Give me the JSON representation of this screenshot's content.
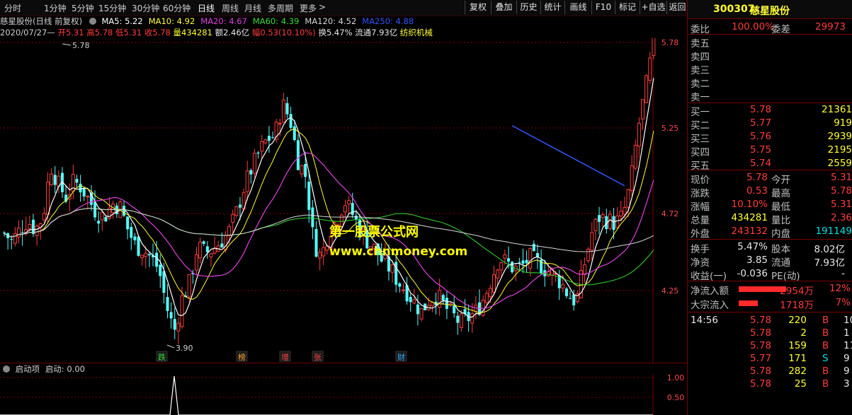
{
  "periods": [
    "分时",
    "1分钟",
    "5分钟",
    "15分钟",
    "30分钟",
    "60分钟",
    "日线",
    "周线",
    "月线",
    "多周期",
    "更多"
  ],
  "active_period": "日线",
  "more_arrow": ">",
  "toolbar": [
    "复权",
    "叠加",
    "历史",
    "统计",
    "画线",
    "F10",
    "标记",
    "+自选",
    "返回"
  ],
  "stock": {
    "code": "300307",
    "name": "慈星股份"
  },
  "chart_title": "慈星股份(日线 前复权)",
  "ma": [
    {
      "label": "MA5: 5.22",
      "color": "#ffffff"
    },
    {
      "label": "MA10: 4.92",
      "color": "#ffff33"
    },
    {
      "label": "MA20: 4.67",
      "color": "#e040e0"
    },
    {
      "label": "MA60: 4.39",
      "color": "#33dd33"
    },
    {
      "label": "MA120: 4.52",
      "color": "#d8d8d8"
    },
    {
      "label": "MA250: 4.88",
      "color": "#3355ff"
    }
  ],
  "ohlc": {
    "date": "2020/07/27—",
    "open_label": "开",
    "open": "5.31",
    "high_label": "高",
    "high": "5.78",
    "low_label": "低",
    "low": "5.31",
    "close_label": "收",
    "close": "5.78",
    "vol_label": "量",
    "vol": "434281",
    "amt_label": "额",
    "amt": "2.46亿",
    "amp_label": "幅",
    "amp": "0.53(10.10%)",
    "turn_label": "换",
    "turn": "5.47%",
    "float_label": "流通",
    "float": "7.93亿",
    "industry": "纺织机械"
  },
  "price_axis": [
    "5.78",
    "5.25",
    "4.72",
    "4.25"
  ],
  "annotations": {
    "high": "5.78",
    "low": "3.90"
  },
  "event_tags": [
    {
      "text": "跌",
      "color": "#33dd33"
    },
    {
      "text": "榜",
      "color": "#ff9933"
    },
    {
      "text": "增",
      "color": "#ff4444"
    },
    {
      "text": "张",
      "color": "#ff4444"
    },
    {
      "text": "财",
      "color": "#33aaff"
    }
  ],
  "watermark": {
    "line1": "第一股票公式网",
    "line2": "www.chnmoney.com"
  },
  "indicator": {
    "name": "启动项",
    "value_label": "启动: 0.00",
    "axis": [
      "1.00",
      "0.50"
    ]
  },
  "side": {
    "weibi_label": "委比",
    "weibi": "100.00%",
    "weicha_label": "委差",
    "weicha": "29973",
    "sells": [
      "卖五",
      "卖四",
      "卖三",
      "卖二",
      "卖一"
    ],
    "buys": [
      {
        "label": "买一",
        "price": "5.78",
        "vol": "21361"
      },
      {
        "label": "买二",
        "price": "5.77",
        "vol": "919"
      },
      {
        "label": "买三",
        "price": "5.76",
        "vol": "2939"
      },
      {
        "label": "买四",
        "price": "5.75",
        "vol": "2195"
      },
      {
        "label": "买五",
        "price": "5.74",
        "vol": "2559"
      }
    ],
    "quote": [
      {
        "l1": "现价",
        "v1": "5.78",
        "l2": "今开",
        "v2": "5.31"
      },
      {
        "l1": "涨跌",
        "v1": "0.53",
        "l2": "最高",
        "v2": "5.78"
      },
      {
        "l1": "涨幅",
        "v1": "10.10%",
        "l2": "最低",
        "v2": "5.31"
      },
      {
        "l1": "总量",
        "v1": "434281",
        "l2": "量比",
        "v2": "2.36"
      },
      {
        "l1": "外盘",
        "v1": "243132",
        "l2": "内盘",
        "v2": "191149"
      }
    ],
    "info": [
      {
        "l1": "换手",
        "v1": "5.47%",
        "l2": "股本",
        "v2": "8.02亿"
      },
      {
        "l1": "净资",
        "v1": "3.85",
        "l2": "流通",
        "v2": "7.93亿"
      },
      {
        "l1": "收益(一)",
        "v1": "-0.036",
        "l2": "PE(动)",
        "v2": "-"
      }
    ],
    "flow": [
      {
        "label": "净流入额",
        "amount": "2954万",
        "pct": "12%",
        "bar_fraction": 0.55
      },
      {
        "label": "大宗流入",
        "amount": "1718万",
        "pct": "7%",
        "bar_fraction": 0.22
      }
    ],
    "ticks_time": "14:56",
    "ticks": [
      {
        "price": "5.78",
        "vol": "220",
        "bs": "B",
        "num": "10"
      },
      {
        "price": "5.78",
        "vol": "2",
        "bs": "B",
        "num": "1"
      },
      {
        "price": "5.78",
        "vol": "159",
        "bs": "B",
        "num": "11"
      },
      {
        "price": "5.77",
        "vol": "171",
        "bs": "S",
        "num": "9"
      },
      {
        "price": "5.78",
        "vol": "282",
        "bs": "B",
        "num": "9"
      },
      {
        "price": "5.78",
        "vol": "25",
        "bs": "B",
        "num": "3"
      }
    ]
  },
  "chart_data": {
    "type": "candlestick",
    "y_axis_ticks": [
      5.78,
      5.25,
      4.72,
      4.25
    ],
    "close_path": [
      4.6,
      4.55,
      4.62,
      4.68,
      4.62,
      4.7,
      5.02,
      4.9,
      4.82,
      4.92,
      4.88,
      4.8,
      4.72,
      4.7,
      4.78,
      4.76,
      4.62,
      4.52,
      4.5,
      4.45,
      4.38,
      4.15,
      4.0,
      4.2,
      4.3,
      4.52,
      4.48,
      4.5,
      4.55,
      4.6,
      4.72,
      4.88,
      5.0,
      5.1,
      5.18,
      5.2,
      5.4,
      5.3,
      5.05,
      4.95,
      4.55,
      4.45,
      4.62,
      4.68,
      4.8,
      4.72,
      4.62,
      4.55,
      4.5,
      4.42,
      4.38,
      4.3,
      4.25,
      4.18,
      4.12,
      4.2,
      4.22,
      4.15,
      4.1,
      4.05,
      4.08,
      4.12,
      4.2,
      4.32,
      4.45,
      4.42,
      4.38,
      4.4,
      4.45,
      4.42,
      4.38,
      4.35,
      4.3,
      4.22,
      4.18,
      4.4,
      4.6,
      4.7,
      4.68,
      4.66,
      4.7,
      4.9,
      5.25,
      5.5,
      5.78
    ],
    "ma_levels": {
      "MA5": 5.22,
      "MA10": 4.92,
      "MA20": 4.67,
      "MA60": 4.39,
      "MA120": 4.52,
      "MA250": 4.88
    }
  }
}
